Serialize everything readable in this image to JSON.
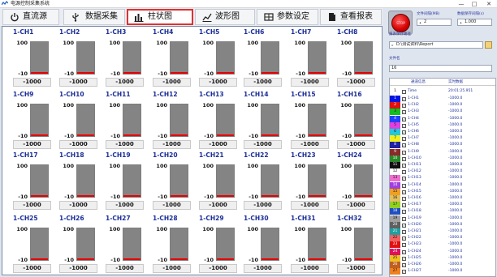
{
  "window": {
    "title": "电源控制采集系统",
    "minimize_glyph": "—",
    "maximize_glyph": "□",
    "close_glyph": "✕"
  },
  "tabs": [
    {
      "label": "直流源",
      "icon": "power-icon",
      "active": false
    },
    {
      "label": "数据采集",
      "icon": "usb-icon",
      "active": false
    },
    {
      "label": "柱状图",
      "icon": "bar-chart-icon",
      "active": true
    },
    {
      "label": "波形图",
      "icon": "line-chart-icon",
      "active": false
    },
    {
      "label": "参数设定",
      "icon": "table-icon",
      "active": false
    },
    {
      "label": "查看报表",
      "icon": "report-icon",
      "active": false
    }
  ],
  "bar_scale": {
    "max": 100,
    "min": -10
  },
  "channels": [
    {
      "name": "1-CH1",
      "value": "-1000"
    },
    {
      "name": "1-CH2",
      "value": "-1000"
    },
    {
      "name": "1-CH3",
      "value": "-1000"
    },
    {
      "name": "1-CH4",
      "value": "-1000"
    },
    {
      "name": "1-CH5",
      "value": "-1000"
    },
    {
      "name": "1-CH6",
      "value": "-1000"
    },
    {
      "name": "1-CH7",
      "value": "-1000"
    },
    {
      "name": "1-CH8",
      "value": "-1000"
    },
    {
      "name": "1-CH9",
      "value": "-1000"
    },
    {
      "name": "1-CH10",
      "value": "-1000"
    },
    {
      "name": "1-CH11",
      "value": "-1000"
    },
    {
      "name": "1-CH12",
      "value": "-1000"
    },
    {
      "name": "1-CH13",
      "value": "-1000"
    },
    {
      "name": "1-CH14",
      "value": "-1000"
    },
    {
      "name": "1-CH15",
      "value": "-1000"
    },
    {
      "name": "1-CH16",
      "value": "-1000"
    },
    {
      "name": "1-CH17",
      "value": "-1000"
    },
    {
      "name": "1-CH18",
      "value": "-1000"
    },
    {
      "name": "1-CH19",
      "value": "-1000"
    },
    {
      "name": "1-CH20",
      "value": "-1000"
    },
    {
      "name": "1-CH21",
      "value": "-1000"
    },
    {
      "name": "1-CH22",
      "value": "-1000"
    },
    {
      "name": "1-CH23",
      "value": "-1000"
    },
    {
      "name": "1-CH24",
      "value": "-1000"
    },
    {
      "name": "1-CH25",
      "value": "-1000"
    },
    {
      "name": "1-CH26",
      "value": "-1000"
    },
    {
      "name": "1-CH27",
      "value": "-1000"
    },
    {
      "name": "1-CH28",
      "value": "-1000"
    },
    {
      "name": "1-CH29",
      "value": "-1000"
    },
    {
      "name": "1-CH30",
      "value": "-1000"
    },
    {
      "name": "1-CH31",
      "value": "-1000"
    },
    {
      "name": "1-CH32",
      "value": "-1000"
    }
  ],
  "right_panel": {
    "stop_button_label": "STOP",
    "file_interval_label": "文件间隔(MB)",
    "file_interval_value": "2",
    "save_interval_label": "数据保存间隔(s)",
    "save_interval_value": "1.000",
    "path_label": "报表保存路径",
    "path_value": "D:\\测试资料\\Report",
    "filename_label": "文件名",
    "filename_value": "16",
    "table": {
      "header_name": "通道信息",
      "header_value": "实时数据",
      "time_row": {
        "name": "Time",
        "value": "20:01:25.951"
      },
      "rows": [
        {
          "idx": "1",
          "color": "#0016e0",
          "name": "1-CH1",
          "value": "-1000.0"
        },
        {
          "idx": "2",
          "color": "#e01010",
          "name": "1-CH2",
          "value": "-1000.0"
        },
        {
          "idx": "3",
          "color": "#10c020",
          "name": "1-CH3",
          "value": "-1000.0"
        },
        {
          "idx": "4",
          "color": "#2040ff",
          "name": "1-CH4",
          "value": "-1000.0"
        },
        {
          "idx": "5",
          "color": "#e040e0",
          "name": "1-CH5",
          "value": "-1000.0"
        },
        {
          "idx": "6",
          "color": "#20c8e0",
          "name": "1-CH6",
          "value": "-1000.0"
        },
        {
          "idx": "7",
          "color": "#f0f020",
          "name": "1-CH7",
          "value": "-1000.0"
        },
        {
          "idx": "8",
          "color": "#2020a0",
          "name": "1-CH8",
          "value": "-1000.0"
        },
        {
          "idx": "9",
          "color": "#8a2a2a",
          "name": "1-CH9",
          "value": "-1000.0"
        },
        {
          "idx": "10",
          "color": "#2a8a2a",
          "name": "1-CH10",
          "value": "-1000.0"
        },
        {
          "idx": "11",
          "color": "#111111",
          "name": "1-CH11",
          "value": "-1000.0"
        },
        {
          "idx": "12",
          "color": "#ffffff",
          "name": "1-CH12",
          "value": "-1000.0"
        },
        {
          "idx": "13",
          "color": "#f06cd0",
          "name": "1-CH13",
          "value": "-1000.0"
        },
        {
          "idx": "14",
          "color": "#a040e0",
          "name": "1-CH14",
          "value": "-1000.0"
        },
        {
          "idx": "15",
          "color": "#f0a020",
          "name": "1-CH15",
          "value": "-1000.0"
        },
        {
          "idx": "16",
          "color": "#e0c060",
          "name": "1-CH16",
          "value": "-1000.0"
        },
        {
          "idx": "17",
          "color": "#90d020",
          "name": "1-CH17",
          "value": "-1000.0"
        },
        {
          "idx": "18",
          "color": "#2050c0",
          "name": "1-CH18",
          "value": "-1000.0"
        },
        {
          "idx": "19",
          "color": "#a0a0a0",
          "name": "1-CH19",
          "value": "-1000.0"
        },
        {
          "idx": "20",
          "color": "#606060",
          "name": "1-CH20",
          "value": "-1000.0"
        },
        {
          "idx": "21",
          "color": "#20a0a0",
          "name": "1-CH21",
          "value": "-1000.0"
        },
        {
          "idx": "22",
          "color": "#f06060",
          "name": "1-CH22",
          "value": "-1000.0"
        },
        {
          "idx": "23",
          "color": "#e01010",
          "name": "1-CH23",
          "value": "-1000.0"
        },
        {
          "idx": "24",
          "color": "#e01060",
          "name": "1-CH24",
          "value": "-1000.0"
        },
        {
          "idx": "25",
          "color": "#f0c020",
          "name": "1-CH25",
          "value": "-1000.0"
        },
        {
          "idx": "26",
          "color": "#c06020",
          "name": "1-CH26",
          "value": "-1000.0"
        },
        {
          "idx": "27",
          "color": "#f08020",
          "name": "1-CH27",
          "value": "-1000.0"
        }
      ]
    }
  },
  "colors": {
    "channel_label": "#1c2f99",
    "active_tab_border": "#e03030",
    "bar_fill": "#e80000",
    "bar_empty": "#8c8c8c"
  }
}
